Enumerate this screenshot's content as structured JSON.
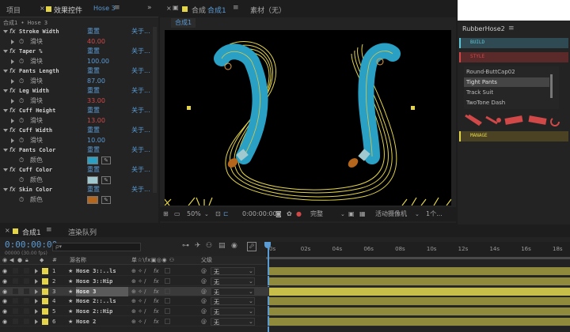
{
  "panels": {
    "project_tab": "项目",
    "effects_tab": "效果控件",
    "effects_layer": "Hose 3",
    "comp_tab_prefix": "合成",
    "comp_tab_name": "合成1",
    "footage_tab": "素材（无）",
    "comp_breadcrumb": "合成1",
    "effects_path": "合成1 • Hose 3"
  },
  "effects": [
    {
      "name": "Stroke Width",
      "reset": "重置",
      "about": "关于...",
      "sub_label": "滑块",
      "value": "40.00",
      "value_color": "red"
    },
    {
      "name": "Taper %",
      "reset": "重置",
      "about": "关于...",
      "sub_label": "滑块",
      "value": "100.00",
      "value_color": "blue"
    },
    {
      "name": "Pants Length",
      "reset": "重置",
      "about": "关于...",
      "sub_label": "滑块",
      "value": "87.00",
      "value_color": "blue"
    },
    {
      "name": "Leg Width",
      "reset": "重置",
      "about": "关于...",
      "sub_label": "滑块",
      "value": "33.00",
      "value_color": "red"
    },
    {
      "name": "Cuff Height",
      "reset": "重置",
      "about": "关于...",
      "sub_label": "滑块",
      "value": "13.00",
      "value_color": "red"
    },
    {
      "name": "Cuff Width",
      "reset": "重置",
      "about": "关于...",
      "sub_label": "滑块",
      "value": "10.00",
      "value_color": "blue"
    }
  ],
  "color_effects": [
    {
      "name": "Pants Color",
      "reset": "重置",
      "about": "关于...",
      "sub_label": "颜色",
      "swatch": "#2aa1c4"
    },
    {
      "name": "Cuff Color",
      "reset": "重置",
      "about": "关于...",
      "sub_label": "颜色",
      "swatch": "#9fc9cf"
    },
    {
      "name": "Skin Color",
      "reset": "重置",
      "about": "关于...",
      "sub_label": "颜色",
      "swatch": "#b4661c"
    }
  ],
  "viewer": {
    "zoom": "50%",
    "timecode": "0:00:00:00",
    "quality": "完整",
    "camera": "活动摄像机",
    "views": "1个..."
  },
  "rubberhose": {
    "title": "RubberHose2",
    "build": "BUILD",
    "style": "STYLE",
    "styles": [
      "Round-ButtCap02",
      "Tight Pants",
      "Track Suit",
      "TwoTone Dash"
    ],
    "selected_style": "Tight Pants",
    "manage": "MANAGE"
  },
  "timeline": {
    "tab_label": "合成1",
    "render_queue": "渲染队列",
    "timecode": "0:00:00:00",
    "fps_note": "00000 (30.00 fps)",
    "search_placeholder": "ρ▾",
    "col_source": "源名称",
    "col_switches": "单☆\\fx▣◎◉ ⚇",
    "col_parent": "父级",
    "ruler": [
      "0s",
      "02s",
      "04s",
      "06s",
      "08s",
      "10s",
      "12s",
      "14s",
      "16s",
      "18s"
    ],
    "layers": [
      {
        "num": "1",
        "name": "Hose 3::..ls",
        "parent": "无",
        "selected": false
      },
      {
        "num": "2",
        "name": "Hose 3::Hip",
        "parent": "无",
        "selected": false
      },
      {
        "num": "3",
        "name": "Hose 3",
        "parent": "无",
        "selected": true
      },
      {
        "num": "4",
        "name": "Hose 2::..ls",
        "parent": "无",
        "selected": false
      },
      {
        "num": "5",
        "name": "Hose 2::Hip",
        "parent": "无",
        "selected": false
      },
      {
        "num": "6",
        "name": "Hose 2",
        "parent": "无",
        "selected": false
      }
    ]
  },
  "colors": {
    "accent_blue": "#5a9bd5",
    "label_yellow": "#e3d44a",
    "hose_blue": "#2aa1c4",
    "layer_bar": "#d7cd5b"
  }
}
